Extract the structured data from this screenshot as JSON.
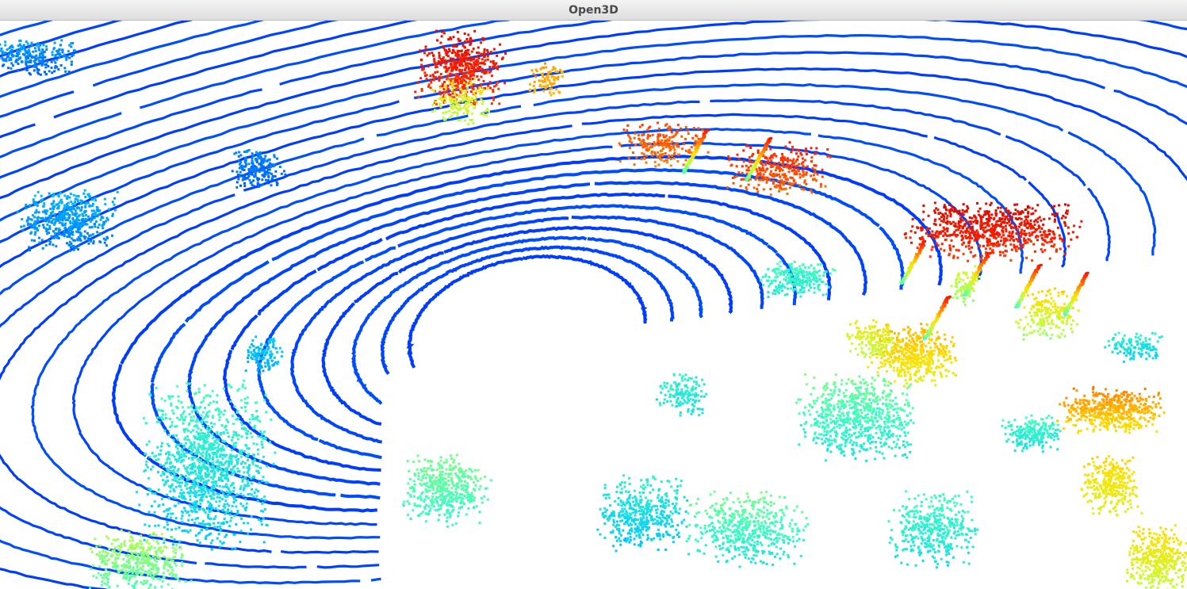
{
  "window": {
    "title": "Open3D"
  },
  "viewport": {
    "content": "point-cloud",
    "background_color": "#ffffff",
    "colormap": {
      "name": "jet",
      "stops": [
        "#00008f",
        "#0000ff",
        "#0060ff",
        "#00c8ff",
        "#40ffbf",
        "#bfff40",
        "#ffe000",
        "#ff8000",
        "#ff2000",
        "#c00000"
      ]
    }
  }
}
